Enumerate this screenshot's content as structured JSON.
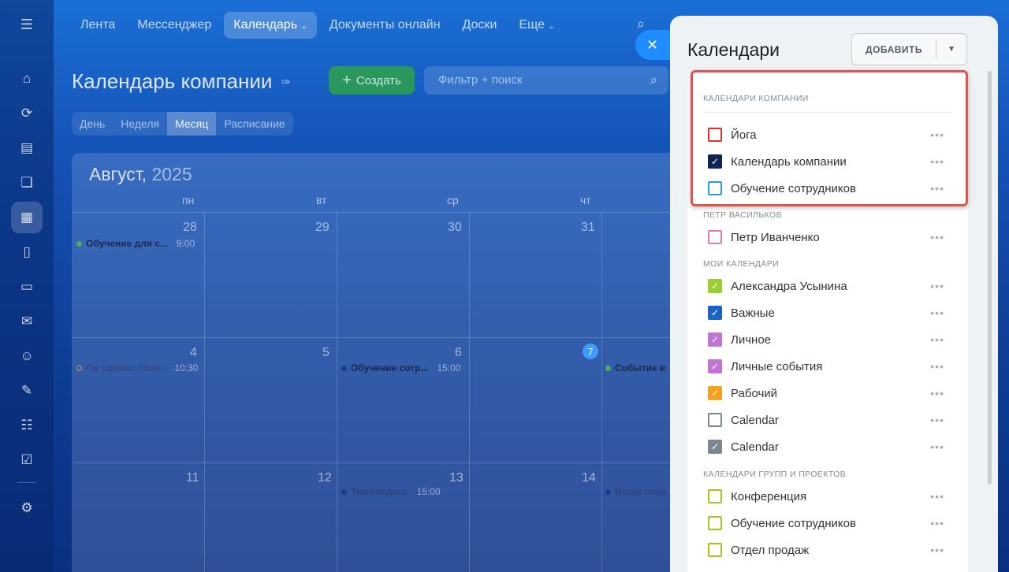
{
  "topnav": {
    "items": [
      "Лента",
      "Мессенджер",
      "Календарь",
      "Документы онлайн",
      "Доски",
      "Еще"
    ],
    "active_index": 2
  },
  "page": {
    "title": "Календарь компании",
    "create_label": "Создать",
    "filter_placeholder": "Фильтр + поиск",
    "views": [
      "День",
      "Неделя",
      "Месяц",
      "Расписание"
    ],
    "active_view": "Месяц"
  },
  "calendar": {
    "month": "Август,",
    "year": "2025",
    "weekdays": [
      "пн",
      "вт",
      "ср",
      "чт"
    ],
    "week1": [
      "28",
      "29",
      "30",
      "31"
    ],
    "week2": [
      "4",
      "5",
      "6",
      "7"
    ],
    "week3": [
      "11",
      "12",
      "13",
      "14"
    ],
    "events": {
      "e1": {
        "title": "Обучение для с...",
        "time": "9:00",
        "color": "#4caf50"
      },
      "e2": {
        "title": "По сделке: Нов...",
        "time": "10:30",
        "color": "#ff9800"
      },
      "e3": {
        "title": "Обучение сотр...",
        "time": "15:00",
        "color": "#1a3c8a"
      },
      "e4": {
        "title": "Событие в",
        "time": "",
        "color": "#4caf50"
      },
      "e5": {
        "title": "Тимбилдинг",
        "time": "15:00",
        "color": "#1a3c8a"
      },
      "e6": {
        "title": "Итоги пола",
        "time": "",
        "color": "#1a3c8a"
      }
    }
  },
  "panel": {
    "title": "Календари",
    "add_label": "ДОБАВИТЬ",
    "sections": {
      "company": "КАЛЕНДАРИ КОМПАНИИ",
      "petr": "ПЕТР ВАСИЛЬКОВ",
      "mine": "МОИ КАЛЕНДАРИ",
      "groups": "КАЛЕНДАРИ ГРУПП И ПРОЕКТОВ"
    },
    "calendars": {
      "yoga": {
        "name": "Йога",
        "color": "#d9342b",
        "checked": false
      },
      "company": {
        "name": "Календарь компании",
        "color": "#0e2454",
        "checked": true
      },
      "training": {
        "name": "Обучение сотрудников",
        "color": "#2c9bd6",
        "checked": false
      },
      "petr": {
        "name": "Петр Иванченко",
        "color": "#e07ba5",
        "checked": false
      },
      "alexandra": {
        "name": "Александра Усынина",
        "color": "#9acd32",
        "checked": true
      },
      "important": {
        "name": "Важные",
        "color": "#1c63c4",
        "checked": true
      },
      "personal": {
        "name": "Личное",
        "color": "#c074d3",
        "checked": true
      },
      "personal_events": {
        "name": "Личные события",
        "color": "#c074d3",
        "checked": true
      },
      "work": {
        "name": "Рабочий",
        "color": "#f7a11e",
        "checked": true
      },
      "cal1": {
        "name": "Calendar",
        "color": "#7d8792",
        "checked": false
      },
      "cal2": {
        "name": "Calendar",
        "color": "#7d8792",
        "checked": true
      },
      "conference": {
        "name": "Конференция",
        "color": "#a7c51a",
        "checked": false
      },
      "training2": {
        "name": "Обучение сотрудников",
        "color": "#a7c51a",
        "checked": false
      },
      "sales": {
        "name": "Отдел продаж",
        "color": "#a7c51a",
        "checked": false
      }
    },
    "more_label": "•••"
  },
  "icons": {
    "close": "✕",
    "check": "✓"
  }
}
